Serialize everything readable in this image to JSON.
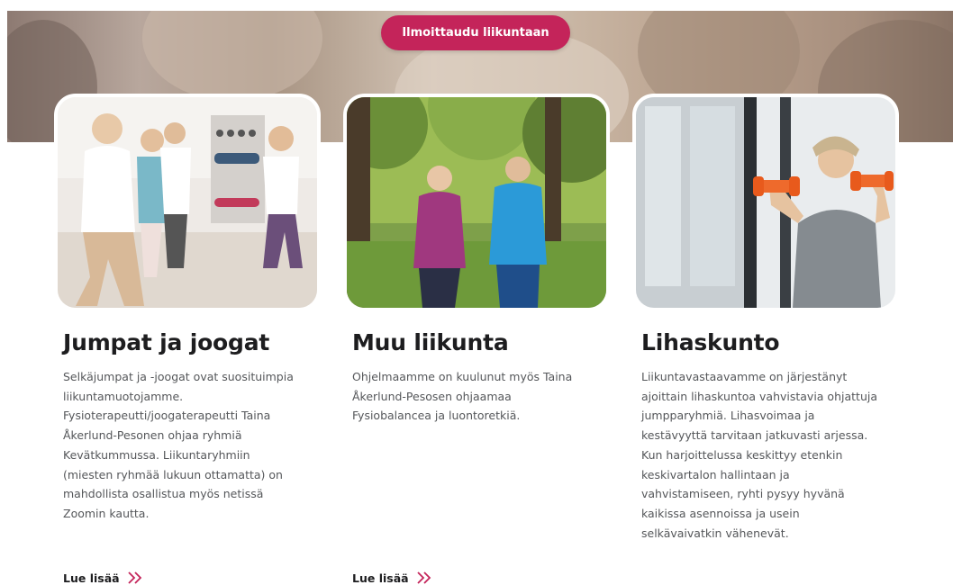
{
  "hero": {
    "cta_label": "Ilmoittaudu liikuntaan"
  },
  "cards": [
    {
      "title": "Jumpat ja joogat",
      "description": "Selkäjumpat ja -joogat ovat suosituimpia\nliikuntamuotojamme.\nFysioterapeutti/joogaterapeutti Taina\nÅkerlund-Pesonen ohjaa ryhmiä\nKevätkummussa. Liikuntaryhmiin\n(miesten ryhmää lukuun ottamatta) on\nmahdollista osallistua myös netissä\nZoomin kautta.",
      "read_more": "Lue lisää"
    },
    {
      "title": "Muu liikunta",
      "description": "Ohjelmaamme on kuulunut myös Taina\nÅkerlund-Pesosen ohjaamaa\nFysiobalancea ja luontoretkiä.",
      "read_more": "Lue lisää"
    },
    {
      "title": "Lihaskunto",
      "description": "Liikuntavastaavamme on järjestänyt\najoittain lihaskuntoa vahvistavia ohjattuja\njumpparyhmiä. Lihasvoimaa ja\nkestävyyttä tarvitaan jatkuvasti arjessa.\nKun harjoittelussa keskittyy etenkin\nkeskivartalon hallintaan ja\nvahvistamiseen, ryhti pysyy hyvänä\nkaikissa asennoissa ja usein\nselkävaivatkin vähenevät."
    }
  ],
  "colors": {
    "accent": "#c4245a",
    "heading": "#1d1d1f",
    "body_text": "#55575a"
  },
  "icons": {
    "read_more": "chevron-double-right-icon"
  }
}
